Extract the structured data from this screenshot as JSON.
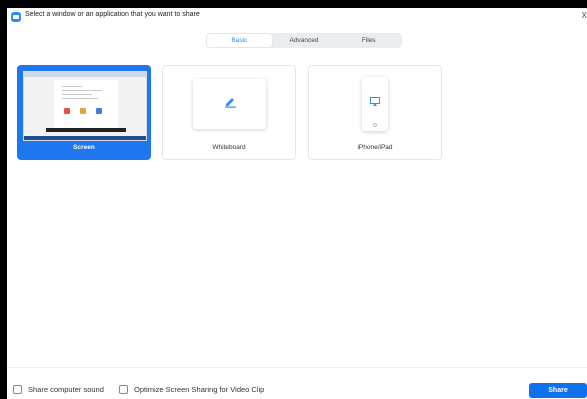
{
  "window": {
    "title": "Select a window or an application that you want to share",
    "close_glyph": "X"
  },
  "tabs": [
    {
      "label": "Basic",
      "active": true
    },
    {
      "label": "Advanced",
      "active": false
    },
    {
      "label": "Files",
      "active": false
    }
  ],
  "sources": [
    {
      "label": "Screen",
      "selected": true,
      "icon": "screen-thumbnail"
    },
    {
      "label": "Whiteboard",
      "selected": false,
      "icon": "pencil-icon"
    },
    {
      "label": "iPhone/iPad",
      "selected": false,
      "icon": "airplay-icon"
    }
  ],
  "footer": {
    "share_sound_label": "Share computer sound",
    "optimize_label": "Optimize Screen Sharing for Video Clip",
    "share_button_label": "Share"
  },
  "colors": {
    "accent": "#2d8cff",
    "selected_card": "#1e77ee",
    "share_button": "#0e72ed",
    "tab_bar": "#e9edf2"
  }
}
